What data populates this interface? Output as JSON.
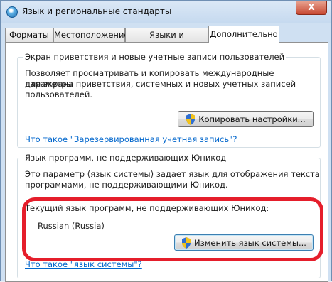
{
  "window": {
    "title": "Язык и региональные стандарты",
    "close_glyph": "X"
  },
  "tabs": [
    {
      "label": "Форматы"
    },
    {
      "label": "Местоположение"
    },
    {
      "label": "Языки и клавиатуры"
    },
    {
      "label": "Дополнительно"
    }
  ],
  "active_tab": "Дополнительно",
  "welcome_group": {
    "title": "Экран приветствия и новые учетные записи пользователей",
    "description_lines": [
      "Позволяет просматривать и копировать международные параметры",
      "для экрана приветствия, системных и новых учетных записей",
      "пользователей."
    ],
    "copy_button": "Копировать настройки...",
    "link": "Что такое \"Зарезервированная учетная запись\"?"
  },
  "unicode_group": {
    "title": "Язык программ, не поддерживающих Юникод",
    "description_lines": [
      "Это параметр (язык системы) задает язык для отображения текста",
      "программами, не поддерживающими Юникод."
    ],
    "current_label": "Текущий язык программ, не поддерживающих Юникод:",
    "current_value": "Russian (Russia)",
    "change_button": "Изменить язык системы...",
    "link": "Что такое \"язык системы\"?"
  },
  "colors": {
    "highlight": "#e51e2b",
    "link": "#0066cc"
  },
  "icons": {
    "title": "globe-icon",
    "buttons": "uac-shield-icon"
  }
}
